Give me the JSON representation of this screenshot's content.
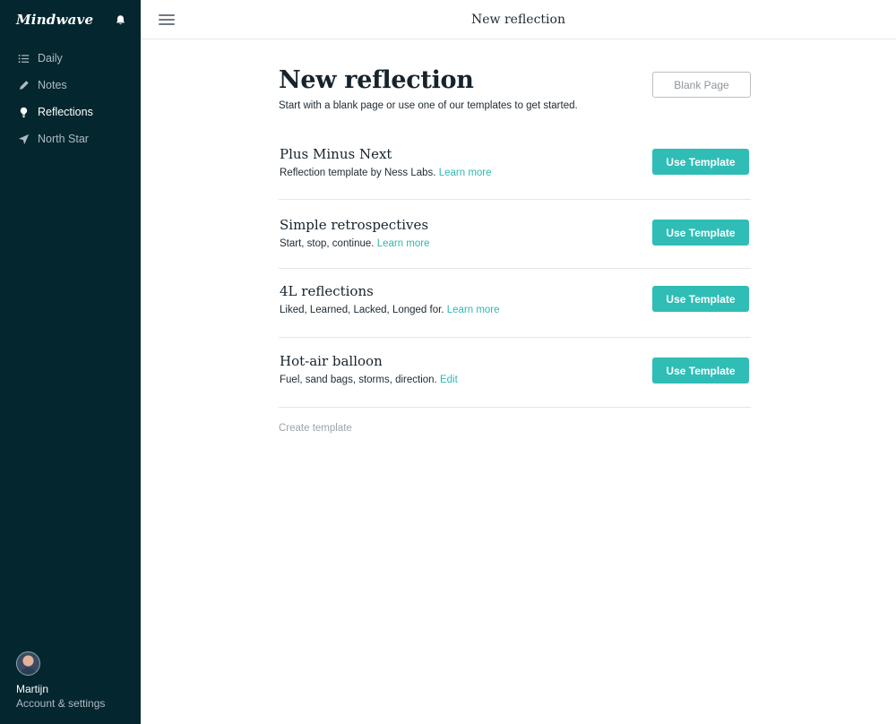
{
  "app": {
    "name": "Mindwave"
  },
  "sidebar": {
    "items": [
      {
        "label": "Daily",
        "icon": "list-icon"
      },
      {
        "label": "Notes",
        "icon": "pen-icon"
      },
      {
        "label": "Reflections",
        "icon": "lightbulb-icon",
        "active": true
      },
      {
        "label": "North Star",
        "icon": "navigation-arrow-icon"
      }
    ],
    "user": {
      "name": "Martijn",
      "settings_label": "Account & settings"
    }
  },
  "topbar": {
    "title": "New reflection"
  },
  "main": {
    "title": "New reflection",
    "subtitle": "Start with a blank page or use one of our templates to get started.",
    "blank_button": "Blank Page",
    "use_button": "Use Template",
    "templates": [
      {
        "name": "Plus Minus Next",
        "description": "Reflection template by Ness Labs.",
        "link": "Learn more"
      },
      {
        "name": "Simple retrospectives",
        "description": "Start, stop, continue.",
        "link": "Learn more"
      },
      {
        "name": "4L reflections",
        "description": "Liked, Learned, Lacked, Longed for.",
        "link": "Learn more"
      },
      {
        "name": "Hot-air balloon",
        "description": "Fuel, sand bags, storms, direction.",
        "link": "Edit"
      }
    ],
    "create_link": "Create template"
  },
  "colors": {
    "sidebar_bg": "#04262f",
    "accent": "#2fbdb6",
    "link": "#2fb9b3"
  }
}
